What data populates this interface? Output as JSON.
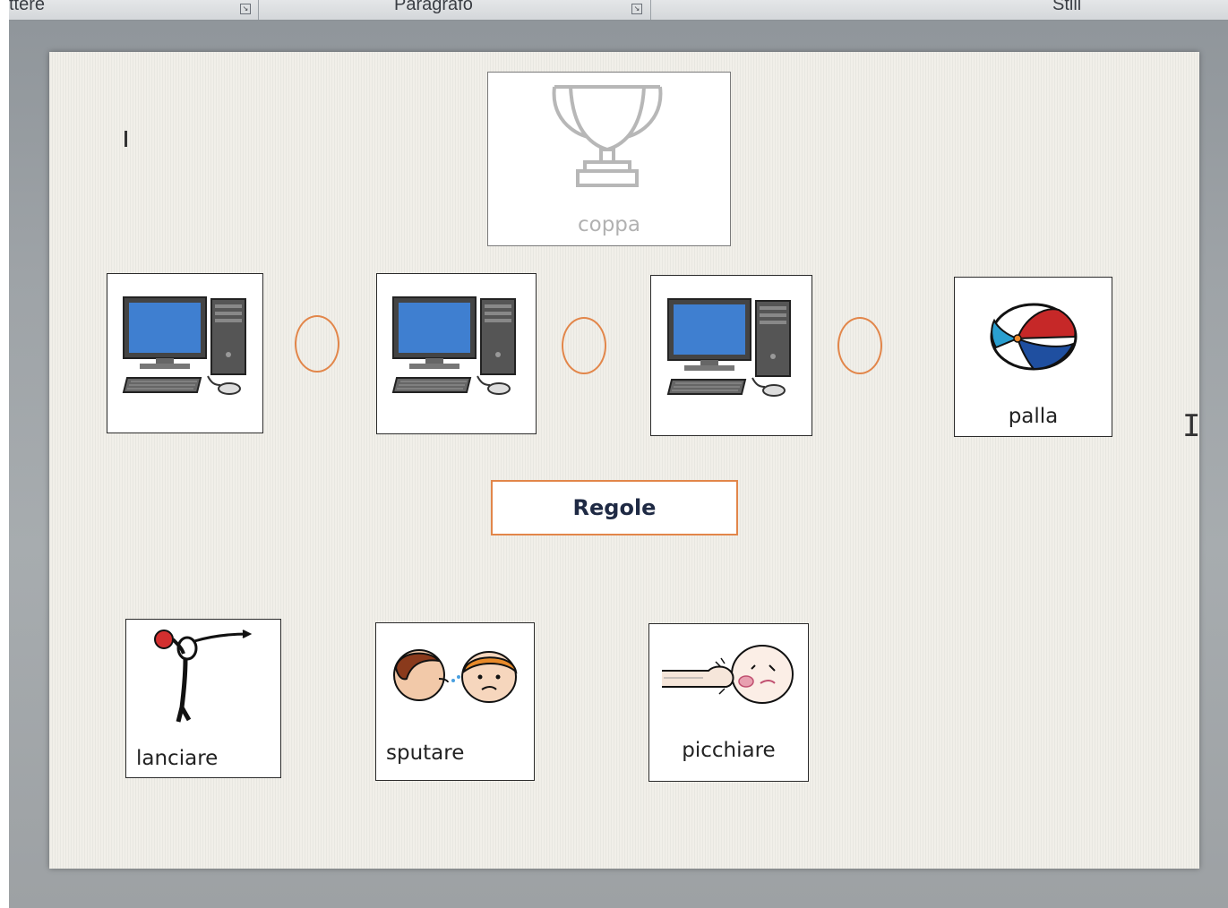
{
  "ribbon": {
    "groups": [
      {
        "label": "ttere"
      },
      {
        "label": "Paragrafo"
      },
      {
        "label": "Stili"
      }
    ]
  },
  "document": {
    "trophy_card": {
      "label": "coppa",
      "icon": "trophy-icon"
    },
    "computer_cards": [
      {
        "icon": "computer-icon"
      },
      {
        "icon": "computer-icon"
      },
      {
        "icon": "computer-icon"
      }
    ],
    "ball_card": {
      "label": "palla",
      "icon": "beach-ball-icon"
    },
    "rules_box": {
      "label": "Regole"
    },
    "action_cards": [
      {
        "label": "lanciare",
        "icon": "throwing-person-icon"
      },
      {
        "label": "sputare",
        "icon": "spitting-faces-icon"
      },
      {
        "label": "picchiare",
        "icon": "punched-face-icon"
      }
    ]
  },
  "colors": {
    "ring": "#e2864a",
    "rules_border": "#e2864a",
    "screen_blue": "#3f7fd0",
    "ball_red": "#c62828",
    "ball_blue": "#1f4fa0"
  }
}
